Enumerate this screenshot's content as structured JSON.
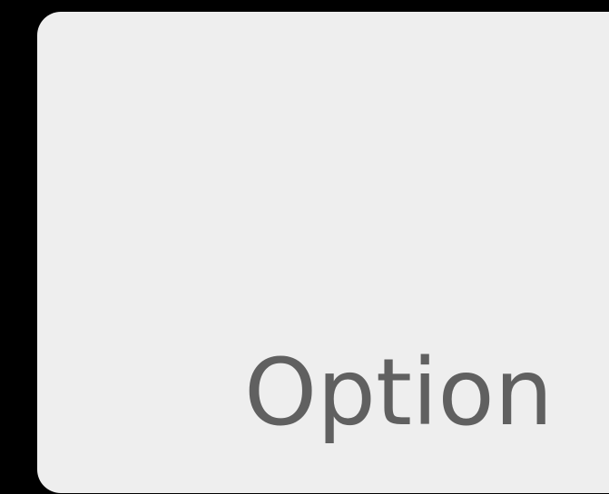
{
  "key": {
    "label": "Option"
  },
  "colors": {
    "background": "#000000",
    "key_face": "#eeeeee",
    "label_text": "#606060"
  }
}
